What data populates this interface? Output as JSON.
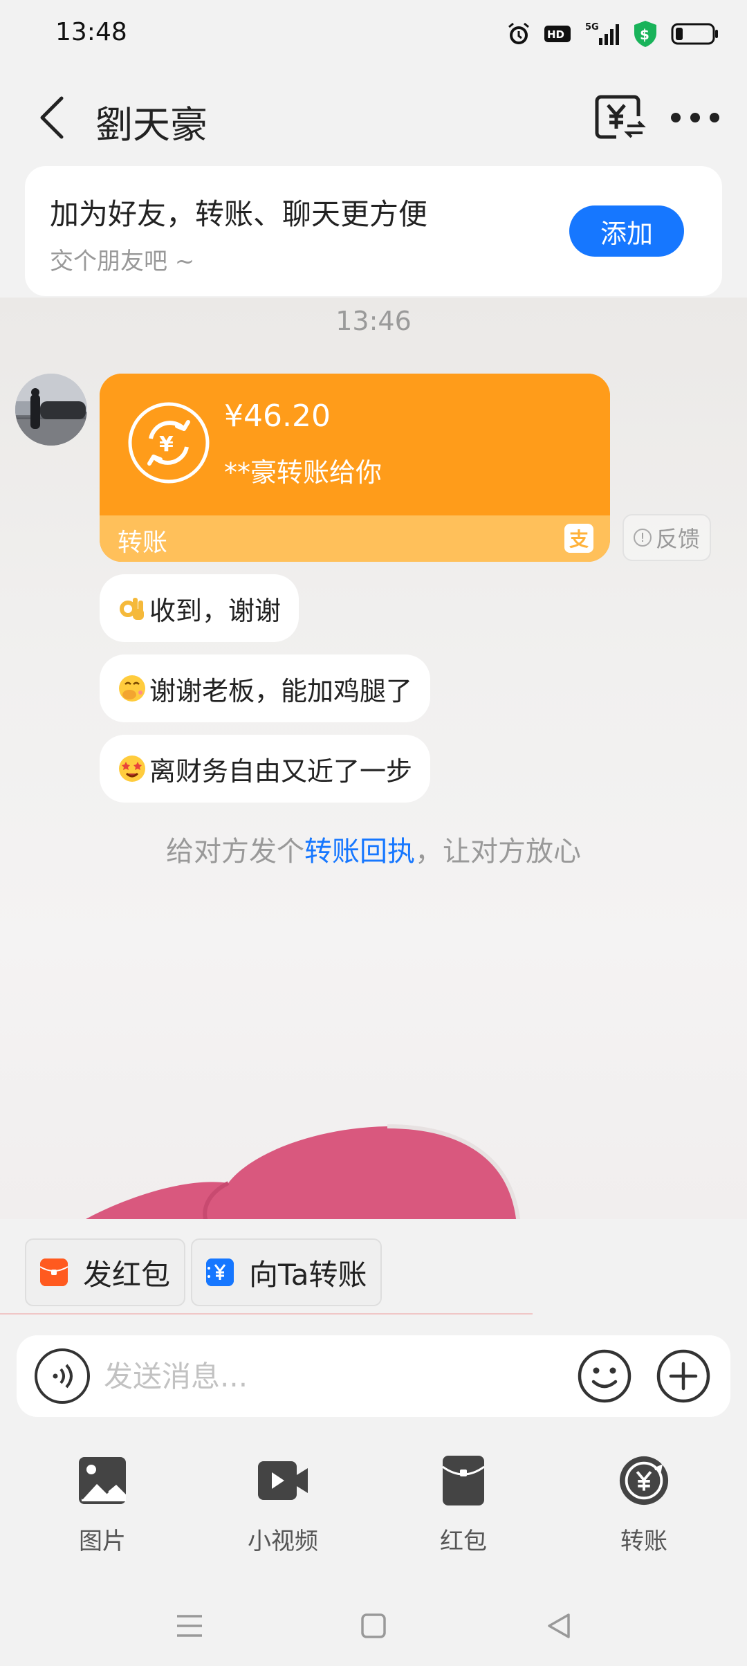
{
  "status_bar": {
    "time": "13:48",
    "hd_label": "HD",
    "network": "5G"
  },
  "header": {
    "title": "劉天豪"
  },
  "friend_card": {
    "title": "加为好友，转账、聊天更方便",
    "subtitle": "交个朋友吧 ~",
    "add_label": "添加"
  },
  "chat": {
    "timestamp": "13:46",
    "transfer": {
      "amount": "¥46.20",
      "from_text": "**豪转账给你",
      "label": "转账"
    },
    "feedback_label": "反馈",
    "messages": [
      {
        "emoji": "ok-hand-emoji",
        "text": "收到，谢谢"
      },
      {
        "emoji": "hand-over-mouth-emoji",
        "text": "谢谢老板，能加鸡腿了"
      },
      {
        "emoji": "star-struck-emoji",
        "text": "离财务自由又近了一步"
      }
    ],
    "receipt_tip": {
      "before": "给对方发个",
      "link": "转账回执",
      "after": "，让对方放心"
    }
  },
  "chips": [
    {
      "label": "发红包",
      "icon": "red-envelope-icon",
      "color": "#ff5a1f"
    },
    {
      "label": "向Ta转账",
      "icon": "yuan-transfer-icon",
      "color": "#1677ff"
    }
  ],
  "input": {
    "placeholder": "发送消息..."
  },
  "tools": [
    {
      "label": "图片",
      "icon": "image-icon"
    },
    {
      "label": "小视频",
      "icon": "video-icon"
    },
    {
      "label": "红包",
      "icon": "red-envelope-icon"
    },
    {
      "label": "转账",
      "icon": "transfer-icon"
    }
  ],
  "colors": {
    "accent": "#1677ff",
    "transfer_orange": "#ff9c1a",
    "transfer_orange_light": "#ffc05a"
  }
}
